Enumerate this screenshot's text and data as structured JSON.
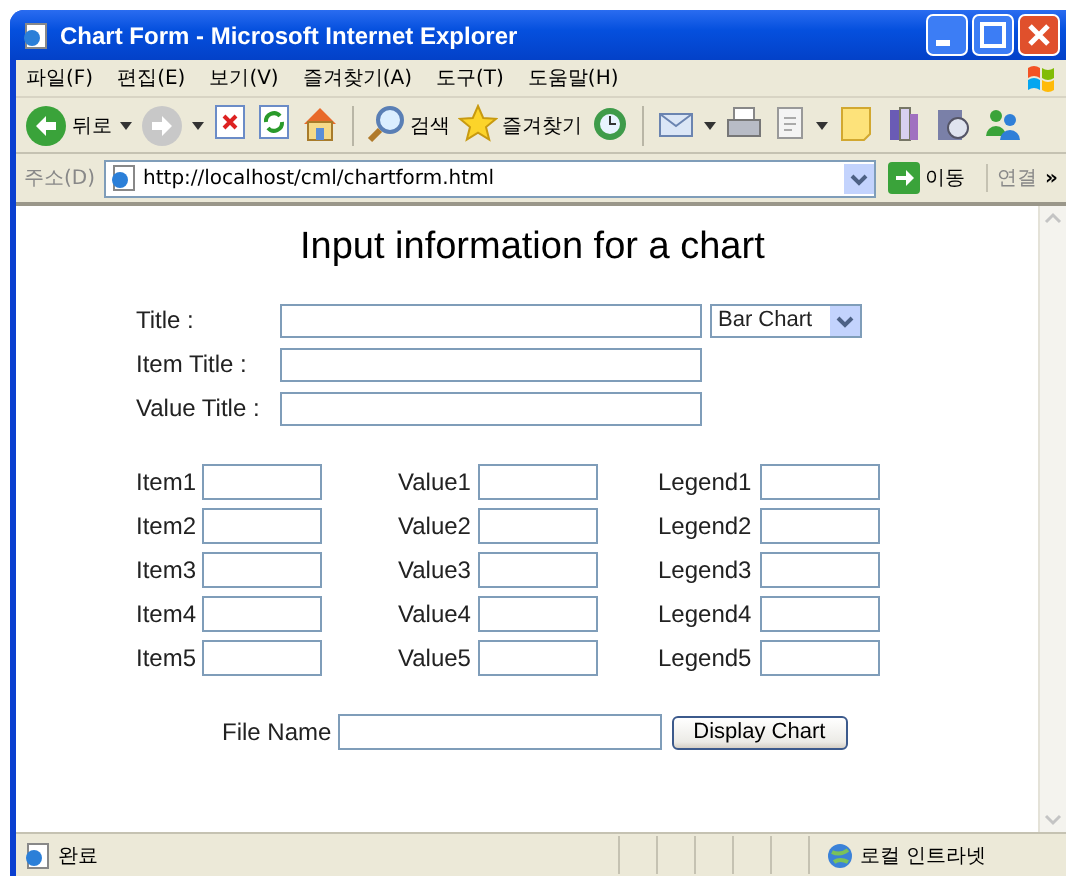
{
  "window": {
    "title": "Chart Form - Microsoft Internet Explorer"
  },
  "menu": [
    "파일(F)",
    "편집(E)",
    "보기(V)",
    "즐겨찾기(A)",
    "도구(T)",
    "도움말(H)"
  ],
  "toolbar": [
    {
      "kind": "back",
      "label": "뒤로",
      "has_menu": true
    },
    {
      "kind": "forward",
      "has_menu": true
    },
    {
      "kind": "stop",
      "has_menu": false
    },
    {
      "kind": "refresh",
      "has_menu": false
    },
    {
      "kind": "home",
      "has_menu": false
    },
    {
      "kind": "search",
      "label": "검색",
      "has_menu": false
    },
    {
      "kind": "favorites",
      "label": "즐겨찾기",
      "has_menu": false
    },
    {
      "kind": "history",
      "has_menu": false
    },
    {
      "kind": "mail",
      "has_menu": true
    },
    {
      "kind": "print",
      "has_menu": false
    },
    {
      "kind": "edit",
      "has_menu": true
    },
    {
      "kind": "note",
      "has_menu": false
    },
    {
      "kind": "research",
      "has_menu": false
    },
    {
      "kind": "media",
      "has_menu": false
    },
    {
      "kind": "messenger",
      "has_menu": false
    }
  ],
  "address_bar": {
    "label": "주소(D)",
    "url": "http://localhost/cml/chartform.html",
    "go": "이동",
    "links": "연결",
    "more": "»"
  },
  "page": {
    "heading": "Input information for a chart",
    "fields": [
      {
        "label": "Title :"
      },
      {
        "label": "Item Title :"
      },
      {
        "label": "Value Title :"
      }
    ],
    "chart_type": "Bar Chart",
    "rows": [
      {
        "item": "Item1",
        "value": "Value1",
        "legend": "Legend1"
      },
      {
        "item": "Item2",
        "value": "Value2",
        "legend": "Legend2"
      },
      {
        "item": "Item3",
        "value": "Value3",
        "legend": "Legend3"
      },
      {
        "item": "Item4",
        "value": "Value4",
        "legend": "Legend4"
      },
      {
        "item": "Item5",
        "value": "Value5",
        "legend": "Legend5"
      }
    ],
    "file_name_label": "File Name",
    "submit": "Display Chart"
  },
  "status_bar": {
    "text": "완료",
    "zone": "로컬 인트라넷"
  }
}
